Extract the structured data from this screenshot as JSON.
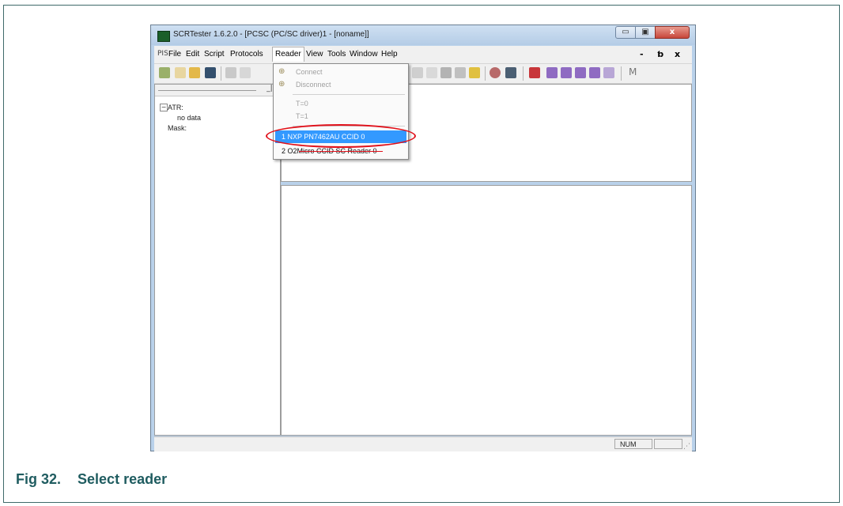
{
  "window": {
    "title": "SCRTester 1.6.2.0 - [PCSC (PC/SC driver)1 - [noname]]",
    "controls": {
      "minimize": "▭",
      "maximize": "▣",
      "close": "x"
    }
  },
  "menubar": {
    "icon_label": "PIS",
    "items": [
      "File",
      "Edit",
      "Script",
      "Protocols",
      "Reader",
      "View",
      "Tools",
      "Window",
      "Help"
    ],
    "mdi_controls": [
      "-",
      "ƅ",
      "x"
    ]
  },
  "toolbar": {
    "right_label": "M"
  },
  "reader_menu": {
    "items": [
      {
        "label": "Connect",
        "icon": "connect-icon"
      },
      {
        "label": "Disconnect",
        "icon": "disconnect-icon"
      },
      {
        "label": "T=0"
      },
      {
        "label": "T=1"
      },
      {
        "label": "1  NXP PN7462AU CCID 0"
      },
      {
        "label": "2  O2Micro CCID SC Reader 0"
      }
    ]
  },
  "tree": {
    "atr": "ATR:",
    "no_data": "no data",
    "mask": "Mask:"
  },
  "statusbar": {
    "num": "NUM"
  },
  "caption": {
    "number": "Fig 32.",
    "text": "Select reader"
  },
  "colors": {
    "highlight": "#3399ff",
    "oval": "#e0101a",
    "caption": "#1f5c60"
  }
}
